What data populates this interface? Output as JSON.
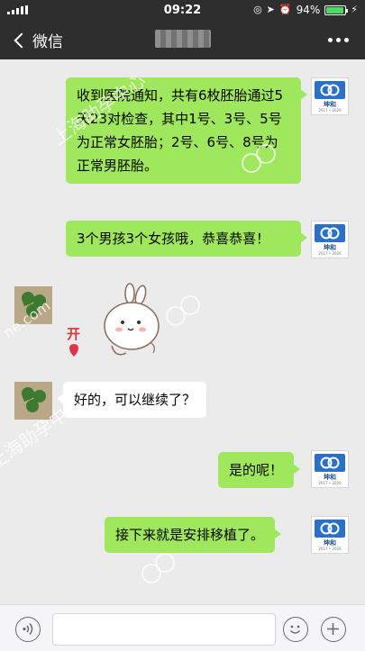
{
  "status_bar": {
    "time": "09:22",
    "battery_text": "94%",
    "battery_level": 0.94
  },
  "nav": {
    "back_label": "微信",
    "title_blurred": true
  },
  "messages": [
    {
      "side": "sent",
      "avatar": "hospital-logo",
      "text": "收到医院通知，共有6枚胚胎通过5天23对检查，其中1号、3号、5号为正常女胚胎；2号、6号、8号为正常男胚胎。"
    },
    {
      "side": "sent",
      "avatar": "hospital-logo",
      "text": "3个男孩3个女孩哦，恭喜恭喜！"
    },
    {
      "side": "received",
      "avatar": "clover",
      "type": "sticker",
      "sticker_text": "开"
    },
    {
      "side": "received",
      "avatar": "clover",
      "text": "好的，可以继续了？"
    },
    {
      "side": "sent",
      "avatar": "hospital-logo",
      "text": "是的呢！"
    },
    {
      "side": "sent",
      "avatar": "hospital-logo",
      "text": "接下来就是安排移植了。"
    }
  ],
  "hospital_logo": {
    "name": "坤和",
    "sub": "2017 • 2026"
  },
  "watermark": {
    "text": "上海助孕中心",
    "fragment": "ne.com"
  },
  "input_bar": {
    "placeholder": ""
  },
  "icons": [
    "back-chevron-icon",
    "more-dots-icon",
    "voice-icon",
    "emoji-icon",
    "plus-icon",
    "location-icon",
    "alarm-icon",
    "charging-icon",
    "signal-icon"
  ]
}
